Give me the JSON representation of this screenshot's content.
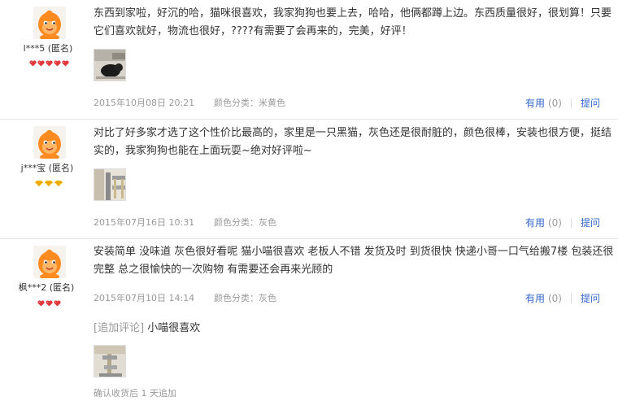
{
  "reviews": [
    {
      "text": "东西到家啦，好沉的哈，猫咪很喜欢，我家狗狗也要上去，哈哈，他俩都蹲上边。东西质量很好，很划算！只要它们喜欢就好，物流也很好，????有需要了会再来的，完美，好评！",
      "user": "l***5 (匿名)",
      "rank_icon": "heart-icon",
      "rank_count": 5,
      "date": "2015年10月08日 20:21",
      "color_label": "颜色分类：米黄色",
      "useful_label": "有用",
      "useful_count": "(0)",
      "reply_label": "提问"
    },
    {
      "text": "对比了好多家才选了这个性价比最高的，家里是一只黑猫，灰色还是很耐脏的，颜色很棒，安装也很方便，挺结实的，我家狗狗也能在上面玩耍~绝对好评啦~",
      "user": "j***宝 (匿名)",
      "rank_icon": "diamond-icon",
      "rank_count": 3,
      "date": "2015年07月16日 10:31",
      "color_label": "颜色分类：灰色",
      "useful_label": "有用",
      "useful_count": "(0)",
      "reply_label": "提问"
    },
    {
      "text": "安装简单 没味道 灰色很好看呢 猫小喵很喜欢 老板人不错 发货及时 到货很快 快递小哥一口气给搬7楼 包装还很完整 总之很愉快的一次购物 有需要还会再来光顾的",
      "user": "枫***2 (匿名)",
      "rank_icon": "heart-icon",
      "rank_count": 3,
      "date": "2015年07月10日 14:14",
      "color_label": "颜色分类：灰色",
      "useful_label": "有用",
      "useful_count": "(0)",
      "reply_label": "提问",
      "append_tag": "[追加评论]",
      "append_text": "小喵很喜欢",
      "append_time": "确认收货后 1 天追加"
    }
  ],
  "colors": {
    "link": "#3366cc",
    "muted": "#999999",
    "heart": "#e4393c",
    "diamond": "#f5b800",
    "avatar": "#ff8a1f"
  }
}
